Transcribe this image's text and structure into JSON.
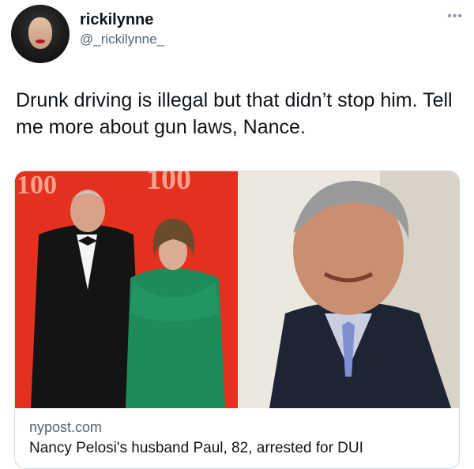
{
  "tweet": {
    "display_name": "rickilynne",
    "handle": "@_rickilynne_",
    "more_icon": "more-icon",
    "text": "Drunk driving is illegal but that didn’t stop him. Tell me more about gun laws, Nance."
  },
  "card": {
    "domain": "nypost.com",
    "title": "Nancy Pelosi's husband Paul, 82, arrested for DUI",
    "backdrop_text_left": "100",
    "backdrop_text_right": "100"
  },
  "colors": {
    "backdrop_red": "#e4301e",
    "dress_green": "#1f8a5a",
    "text_secondary": "#536471"
  }
}
